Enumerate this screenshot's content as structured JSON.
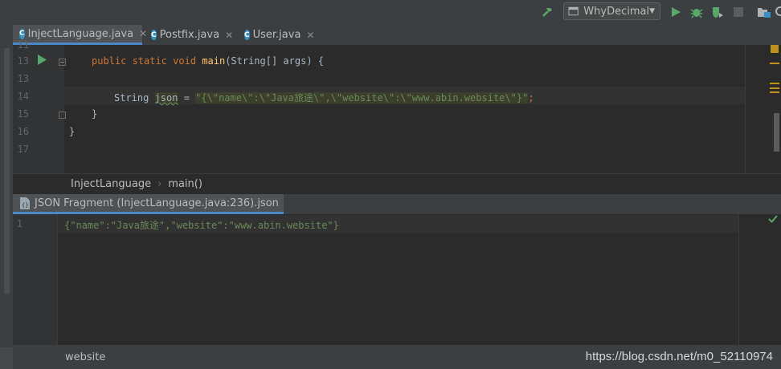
{
  "toolbar": {
    "run_config": "WhyDecimal",
    "colors": {
      "green": "#59a869",
      "accent": "#4a88c7"
    }
  },
  "tabs": [
    {
      "label": "InjectLanguage.java",
      "active": true
    },
    {
      "label": "Postfix.java",
      "active": false
    },
    {
      "label": "User.java",
      "active": false
    }
  ],
  "editor": {
    "line_numbers": [
      "11",
      "13",
      "13",
      "14",
      "15",
      "16",
      "17"
    ],
    "code": {
      "line13_kw": "public static void ",
      "line13_fn": "main",
      "line13_rest": "(String[] args) {",
      "line14_type": "String ",
      "line14_var": "json",
      "line14_eq": " = ",
      "line14_str": "\"{\\\"name\\\":\\\"Java旅途\\\",\\\"website\\\":\\\"www.abin.website\\\"}\"",
      "line14_end": ";",
      "line15": "}",
      "line16": "}"
    }
  },
  "breadcrumb": {
    "class": "InjectLanguage",
    "separator": "›",
    "method": "main()"
  },
  "fragment": {
    "tab_label": "JSON Fragment (InjectLanguage.java:236).json",
    "line_number": "1",
    "content": "{\"name\":\"Java旅途\",\"website\":\"www.abin.website\"}"
  },
  "status": {
    "path": "website"
  },
  "watermark": "https://blog.csdn.net/m0_52110974"
}
